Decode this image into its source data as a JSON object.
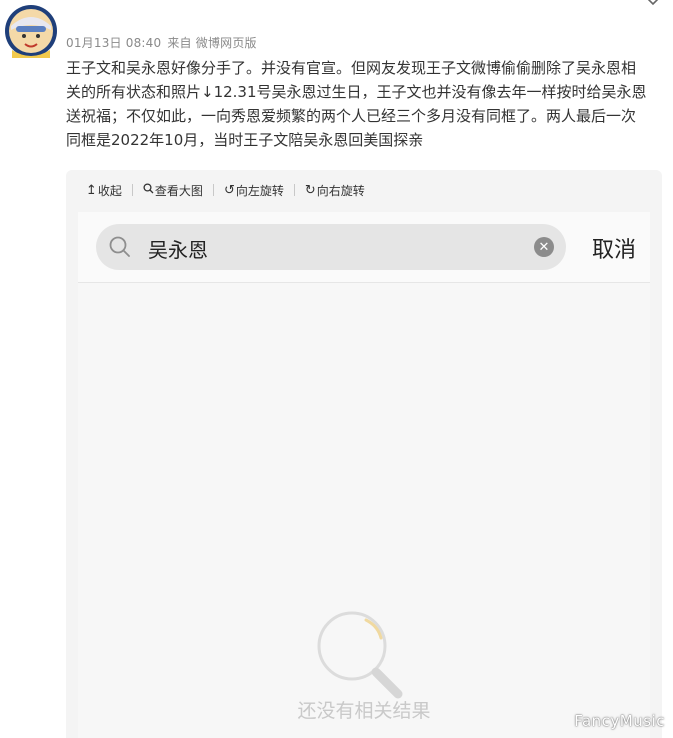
{
  "post": {
    "timestamp": "01月13日 08:40",
    "source": "来自 微博网页版",
    "lines": [
      "王子文和吴永恩好像分手了。并没有官宣。但网友发现王子文微博偷偷删除了吴永恩相",
      "关的所有状态和照片↓12.31号吴永恩过生日，王子文也并没有像去年一样按时给吴永恩",
      "送祝福；不仅如此，一向秀恩爱频繁的两个人已经三个多月没有同框了。两人最后一次",
      "同框是2022年10月，当时王子文陪吴永恩回美国探亲"
    ]
  },
  "toolbar": {
    "collapse": "收起",
    "view_large": "查看大图",
    "rotate_left": "向左旋转",
    "rotate_right": "向右旋转"
  },
  "search": {
    "query": "吴永恩",
    "cancel": "取消",
    "empty_result": "还没有相关结果"
  },
  "watermark": "FancyMusic",
  "icons": {
    "avatar": "avatar-icon",
    "menu": "chevron-down-icon",
    "search": "search-icon",
    "clear": "clear-icon",
    "empty": "magnifier-empty-icon"
  },
  "colors": {
    "meta": "#8a8a8a",
    "search_box": "#e5e5e5",
    "empty_text": "#c9c9c9"
  }
}
